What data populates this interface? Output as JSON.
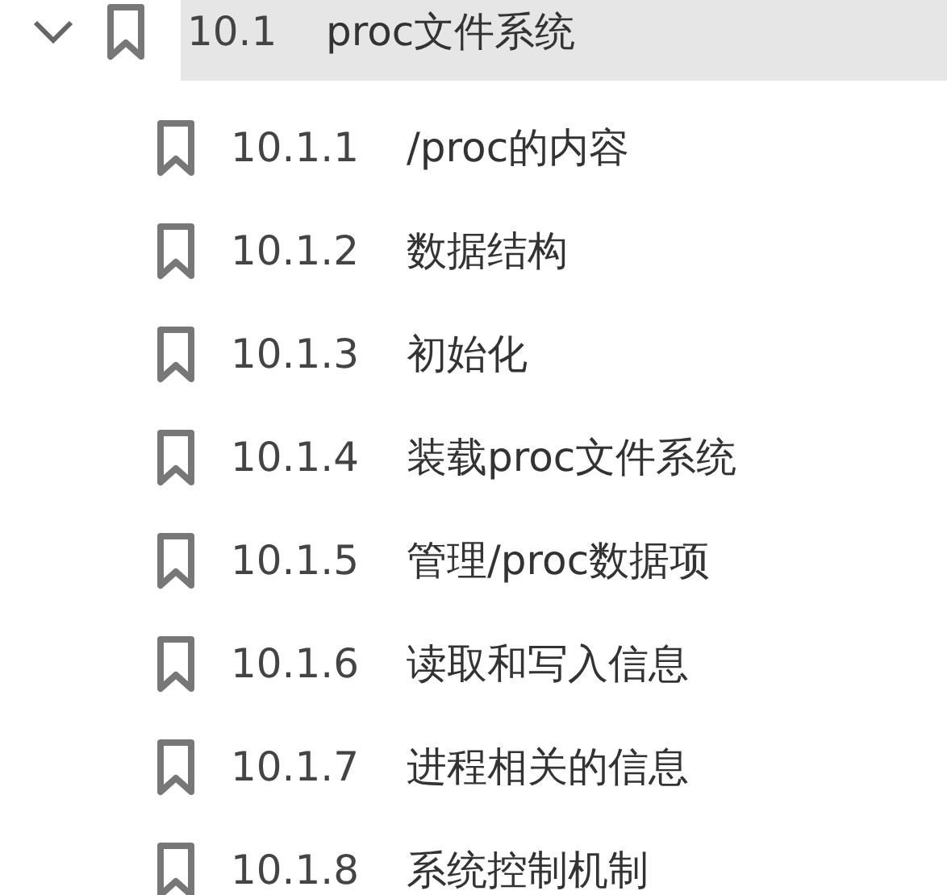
{
  "outline": {
    "items": [
      {
        "number": "10.1",
        "title": "proc文件系统",
        "expanded": true,
        "selected": true,
        "children": [
          {
            "number": "10.1.1",
            "title": "/proc的内容",
            "selected": false
          },
          {
            "number": "10.1.2",
            "title": "数据结构",
            "selected": false
          },
          {
            "number": "10.1.3",
            "title": "初始化",
            "selected": false
          },
          {
            "number": "10.1.4",
            "title": "装载proc文件系统",
            "selected": false
          },
          {
            "number": "10.1.5",
            "title": "管理/proc数据项",
            "selected": false
          },
          {
            "number": "10.1.6",
            "title": "读取和写入信息",
            "selected": false
          },
          {
            "number": "10.1.7",
            "title": "进程相关的信息",
            "selected": false
          },
          {
            "number": "10.1.8",
            "title": "系统控制机制",
            "selected": false
          }
        ]
      }
    ]
  }
}
